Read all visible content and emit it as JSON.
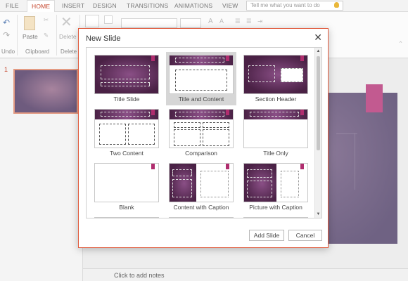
{
  "ribbon_tabs": [
    {
      "label": "FILE"
    },
    {
      "label": "HOME"
    },
    {
      "label": "INSERT"
    },
    {
      "label": "DESIGN"
    },
    {
      "label": "TRANSITIONS"
    },
    {
      "label": "ANIMATIONS"
    },
    {
      "label": "VIEW"
    }
  ],
  "tell_me": {
    "placeholder": "Tell me what you want to do"
  },
  "ribbon": {
    "paste_label": "Paste",
    "delete_label": "Delete",
    "undo_group": "Undo",
    "clipboard_group": "Clipboard",
    "delete_group": "Delete"
  },
  "slides_pane": {
    "number": "1"
  },
  "notes": {
    "placeholder": "Click to add notes"
  },
  "dialog": {
    "title": "New Slide",
    "layouts": [
      {
        "label": "Title Slide"
      },
      {
        "label": "Title and Content"
      },
      {
        "label": "Section Header"
      },
      {
        "label": "Two Content"
      },
      {
        "label": "Comparison"
      },
      {
        "label": "Title Only"
      },
      {
        "label": "Blank"
      },
      {
        "label": "Content with Caption"
      },
      {
        "label": "Picture with Caption"
      }
    ],
    "add_button": "Add Slide",
    "cancel_button": "Cancel"
  },
  "colors": {
    "accent": "#e05a3c",
    "theme_dark": "#4a2145",
    "theme_marker": "#b02d6e",
    "slide_bg": "#6f6283"
  }
}
